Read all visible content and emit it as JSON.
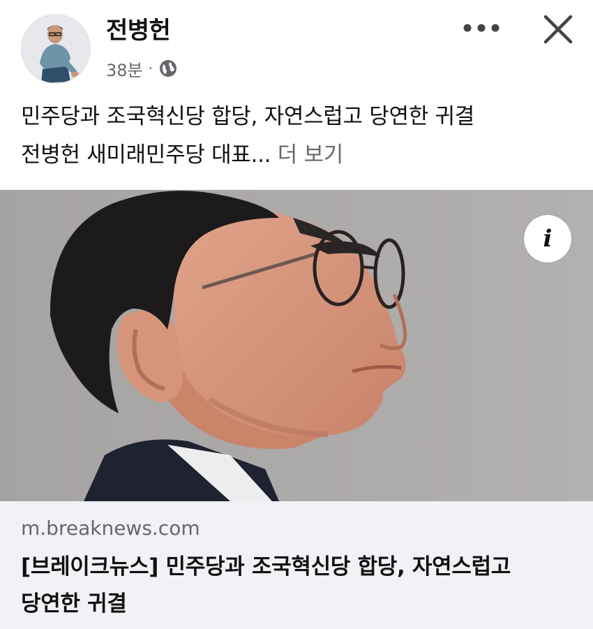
{
  "author": {
    "name": "전병헌",
    "time": "38분",
    "separator": "·",
    "privacy_icon": "globe-icon"
  },
  "header_actions": {
    "more_icon": "more-options-icon",
    "close_icon": "close-icon"
  },
  "post": {
    "line1": "민주당과 조국혁신당 합당, 자연스럽고 당연한 귀결",
    "line2": "전병헌 새미래민주당 대표...",
    "see_more": "더 보기"
  },
  "link_preview": {
    "info_icon": "info-icon",
    "info_glyph": "i",
    "domain": "m.breaknews.com",
    "title_line1": "[브레이크뉴스] 민주당과 조국혁신당 합당, 자연스럽고",
    "title_line2": "당연한 귀결"
  },
  "colors": {
    "text": "#111111",
    "secondary_text": "#65676b",
    "caption_background": "#f0f2f5",
    "photo_background": "#a9a6a6"
  }
}
